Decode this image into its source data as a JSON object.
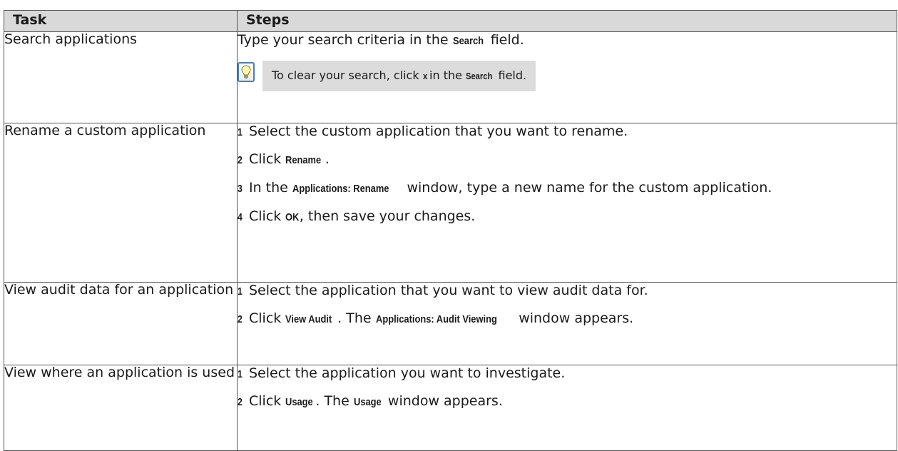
{
  "headers": {
    "task": "Task",
    "steps": "Steps"
  },
  "rows": [
    {
      "task": "Search applications",
      "step": {
        "pre": "Type your search criteria in the ",
        "ui": "Search",
        "post": " field."
      },
      "tip": {
        "pre": "To clear your search, click ",
        "ui1": "x",
        "mid": " in the ",
        "ui2": "Search",
        "post": " field.",
        "icon": "lightbulb-icon"
      }
    },
    {
      "task": "Rename a custom application",
      "steps": [
        {
          "num": "1",
          "pre": "Select the custom application that you want to rename."
        },
        {
          "num": "2",
          "pre": "Click ",
          "ui": "Rename",
          "post": "."
        },
        {
          "num": "3",
          "pre": "In the ",
          "ui": "Applications: Rename",
          "post": " window, type a new name for the custom application."
        },
        {
          "num": "4",
          "pre": "Click ",
          "ui": "OK",
          "post": ", then save your changes."
        }
      ]
    },
    {
      "task": "View audit data for an application",
      "steps": [
        {
          "num": "1",
          "pre": "Select the application that you want to view audit data for."
        },
        {
          "num": "2",
          "pre": "Click ",
          "ui": "View Audit",
          "mid": ". The ",
          "ui2": "Applications: Audit Viewing",
          "post": " window appears."
        }
      ]
    },
    {
      "task": "View where an application is used",
      "steps": [
        {
          "num": "1",
          "pre": "Select the application you want to investigate."
        },
        {
          "num": "2",
          "pre": "Click ",
          "ui": "Usage",
          "mid": ". The ",
          "ui2": "Usage",
          "post": " window appears."
        }
      ]
    }
  ]
}
